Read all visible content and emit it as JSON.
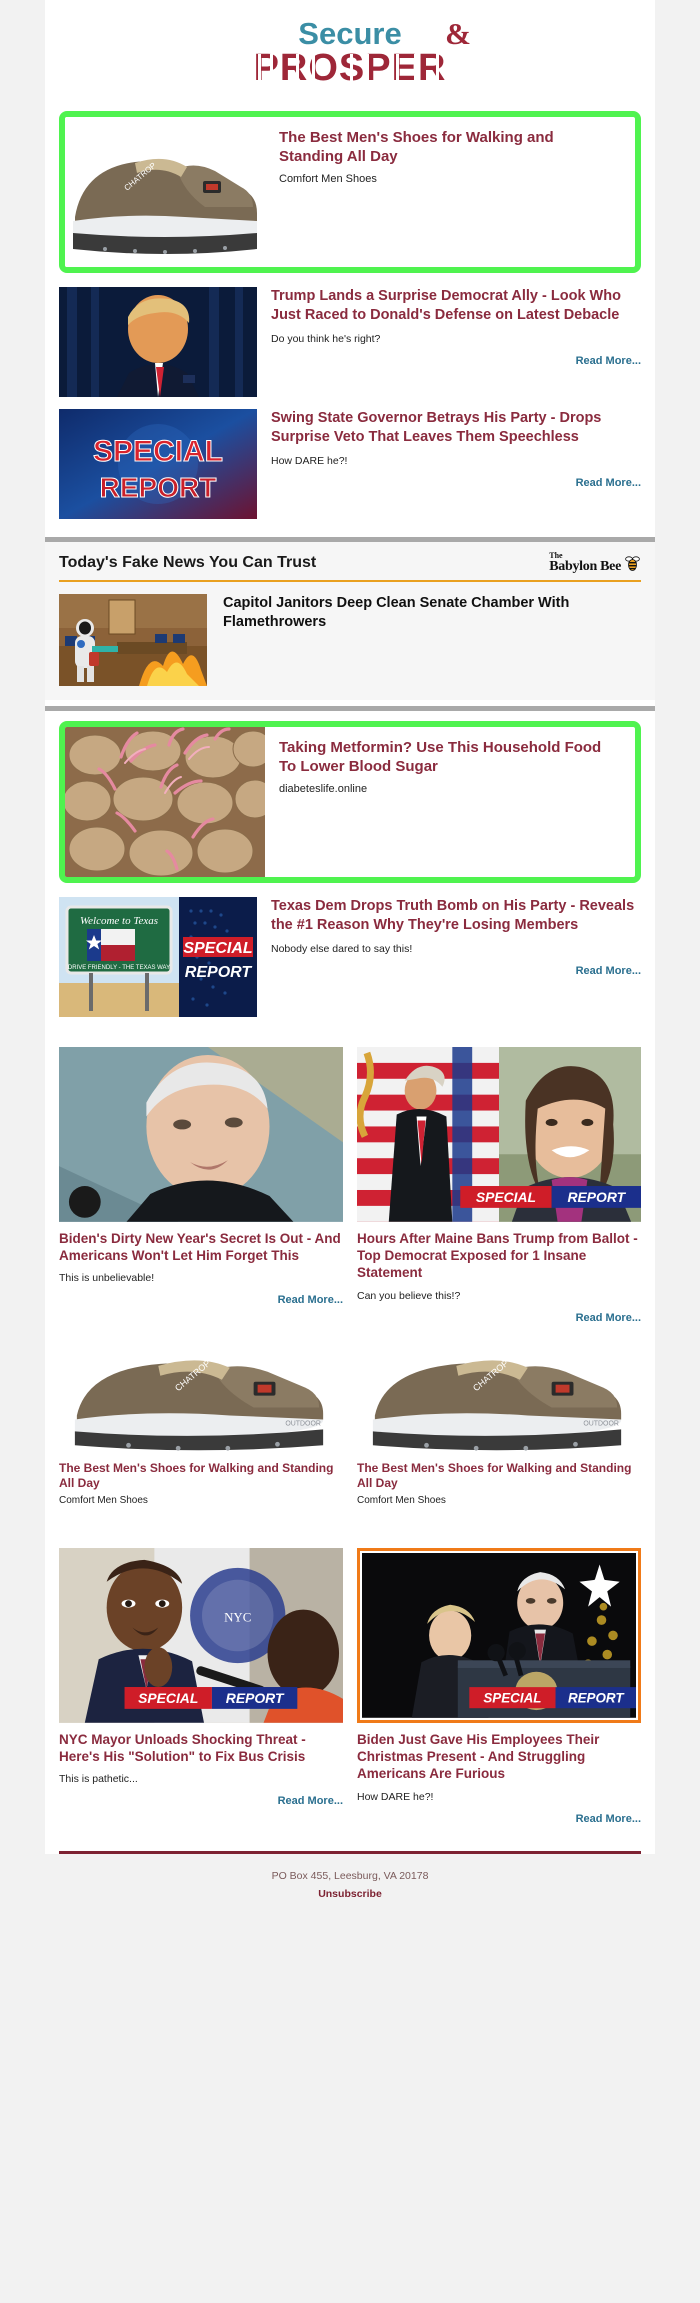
{
  "brand": {
    "line1": "Secure",
    "amp": "&",
    "line2": "PROSPER",
    "color_teal": "#3b8ea5",
    "color_red": "#9e2738"
  },
  "sponsored_top": {
    "title": "The Best Men's Shoes for Walking and Standing All Day",
    "source": "Comfort Men Shoes",
    "border_color": "#4ff34f",
    "image_alt": "mens-slip-on-shoe"
  },
  "articles": [
    {
      "title": "Trump Lands a Surprise Democrat Ally - Look Who Just Raced to Donald's Defense on Latest Debacle",
      "subtitle": "Do you think he's right?",
      "read_more": "Read More...",
      "image_alt": "trump-portrait-blue-curtain"
    },
    {
      "title": "Swing State Governor Betrays His Party - Drops Surprise Veto That Leaves Them Speechless",
      "subtitle": "How DARE he?!",
      "read_more": "Read More...",
      "image_alt": "special-report-graphic"
    }
  ],
  "bee": {
    "heading": "Today's Fake News You Can Trust",
    "logo_the": "The",
    "logo_name": "Babylon Bee",
    "logo_icon": "bee-icon",
    "rule_color": "#e9a020",
    "article": {
      "title": "Capitol Janitors Deep Clean Senate Chamber With Flamethrowers",
      "image_alt": "astronaut-flamethrower-senate-chamber"
    }
  },
  "sponsored_mid": {
    "title": "Taking Metformin? Use This Household Food To Lower Blood Sugar",
    "source": "diabeteslife.online",
    "border_color": "#4ff34f",
    "image_alt": "sprouting-potatoes"
  },
  "texas": {
    "title": "Texas Dem Drops Truth Bomb on His Party - Reveals the #1 Reason Why They're Losing Members",
    "subtitle": "Nobody else dared to say this!",
    "read_more": "Read More...",
    "image_alt": "welcome-to-texas-sign-special-report"
  },
  "duo_news_1": [
    {
      "title": "Biden's Dirty New Year's Secret Is Out - And Americans Won't Let Him Forget This",
      "subtitle": "This is unbelievable!",
      "read_more": "Read More...",
      "image_alt": "biden-closeup-portrait"
    },
    {
      "title": "Hours After Maine Bans Trump from Ballot - Top Democrat Exposed for 1 Insane Statement",
      "subtitle": "Can you believe this!?",
      "read_more": "Read More...",
      "image_alt": "trump-flag-and-woman-special-report"
    }
  ],
  "duo_shoes": [
    {
      "title": "The Best Men's Shoes for Walking and Standing All Day",
      "source": "Comfort Men Shoes",
      "image_alt": "mens-slip-on-shoe"
    },
    {
      "title": "The Best Men's Shoes for Walking and Standing All Day",
      "source": "Comfort Men Shoes",
      "image_alt": "mens-slip-on-shoe"
    }
  ],
  "duo_news_2": [
    {
      "title": "NYC Mayor Unloads Shocking Threat - Here's His \"Solution\" to Fix Bus Crisis",
      "subtitle": "This is pathetic...",
      "read_more": "Read More...",
      "image_alt": "nyc-mayor-eric-adams-special-report",
      "framed": false
    },
    {
      "title": "Biden Just Gave His Employees Their Christmas Present - And Struggling Americans Are Furious",
      "subtitle": "How DARE he?!",
      "read_more": "Read More...",
      "image_alt": "biden-christmas-podium-special-report",
      "framed": true,
      "frame_color": "#f07a18"
    }
  ],
  "footer": {
    "address": "PO Box 455, Leesburg, VA 20178",
    "unsubscribe": "Unsubscribe",
    "rule_color": "#7d2232"
  }
}
